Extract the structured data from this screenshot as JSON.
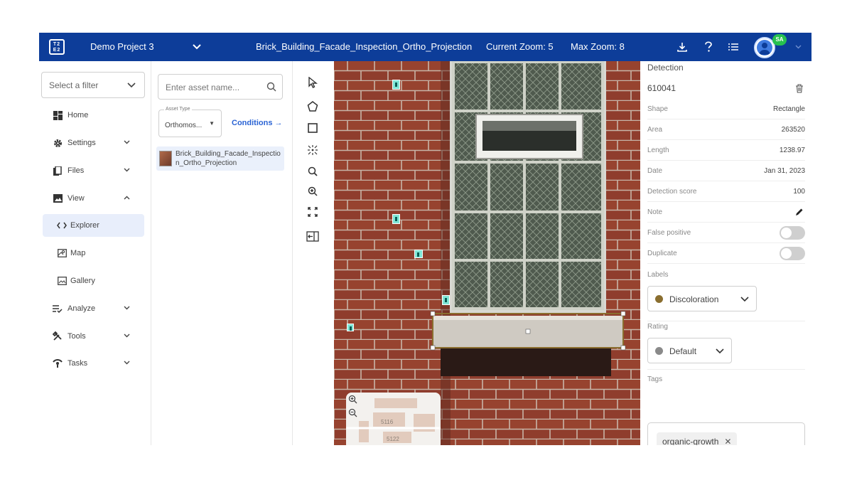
{
  "header": {
    "logo_text": "T2\nE2",
    "project_name": "Demo Project 3",
    "asset_title": "Brick_Building_Facade_Inspection_Ortho_Projection",
    "current_zoom": "Current Zoom: 5",
    "max_zoom": "Max Zoom: 8",
    "avatar_initials": "SA",
    "icons": [
      "download-icon",
      "help-icon",
      "list-icon",
      "user-avatar",
      "chevron-down-icon"
    ]
  },
  "sidebar": {
    "filter_placeholder": "Select a filter",
    "items": [
      {
        "label": "Home",
        "icon": "home-icon"
      },
      {
        "label": "Settings",
        "icon": "gear-icon"
      },
      {
        "label": "Files",
        "icon": "files-icon"
      },
      {
        "label": "View",
        "icon": "image-icon"
      },
      {
        "label": "Explorer",
        "icon": "code-icon"
      },
      {
        "label": "Map",
        "icon": "map-icon"
      },
      {
        "label": "Gallery",
        "icon": "gallery-icon"
      },
      {
        "label": "Analyze",
        "icon": "analyze-icon"
      },
      {
        "label": "Tools",
        "icon": "tools-icon"
      },
      {
        "label": "Tasks",
        "icon": "tasks-icon"
      }
    ]
  },
  "assets": {
    "search_placeholder": "Enter asset name...",
    "type_label": "Asset Type",
    "type_value": "Orthomos...",
    "conditions_label": "Conditions →",
    "list": [
      {
        "name": "Brick_Building_Facade_Inspection_Ortho_Projection"
      }
    ]
  },
  "tools": [
    "select-tool-icon",
    "polygon-tool-icon",
    "rectangle-tool-icon",
    "magic-wand-icon",
    "zoom-out-icon",
    "zoom-in-icon",
    "fit-screen-icon",
    "collapse-panel-icon"
  ],
  "canvas": {
    "minimap_labels": [
      "5116",
      "5122"
    ]
  },
  "details": {
    "title": "Detection",
    "id": "610041",
    "rows": [
      {
        "key": "Shape",
        "value": "Rectangle"
      },
      {
        "key": "Area",
        "value": "263520"
      },
      {
        "key": "Length",
        "value": "1238.97"
      },
      {
        "key": "Date",
        "value": "Jan 31, 2023"
      },
      {
        "key": "Detection score",
        "value": "100"
      },
      {
        "key": "Note",
        "value": ""
      },
      {
        "key": "False positive",
        "value": ""
      },
      {
        "key": "Duplicate",
        "value": ""
      }
    ],
    "toggles": {
      "false_positive": false,
      "duplicate": false
    },
    "labels_title": "Labels",
    "label_value": "Discoloration",
    "label_color": "#8a6e2f",
    "rating_title": "Rating",
    "rating_value": "Default",
    "rating_color": "#8a8a8a",
    "tags_title": "Tags",
    "tags": [
      "organic-growth"
    ]
  },
  "colors": {
    "header_bg": "#0d3d99",
    "accent": "#2a63d4",
    "handle": "#7fe6d6",
    "selection_box": "#8a6e2f"
  }
}
